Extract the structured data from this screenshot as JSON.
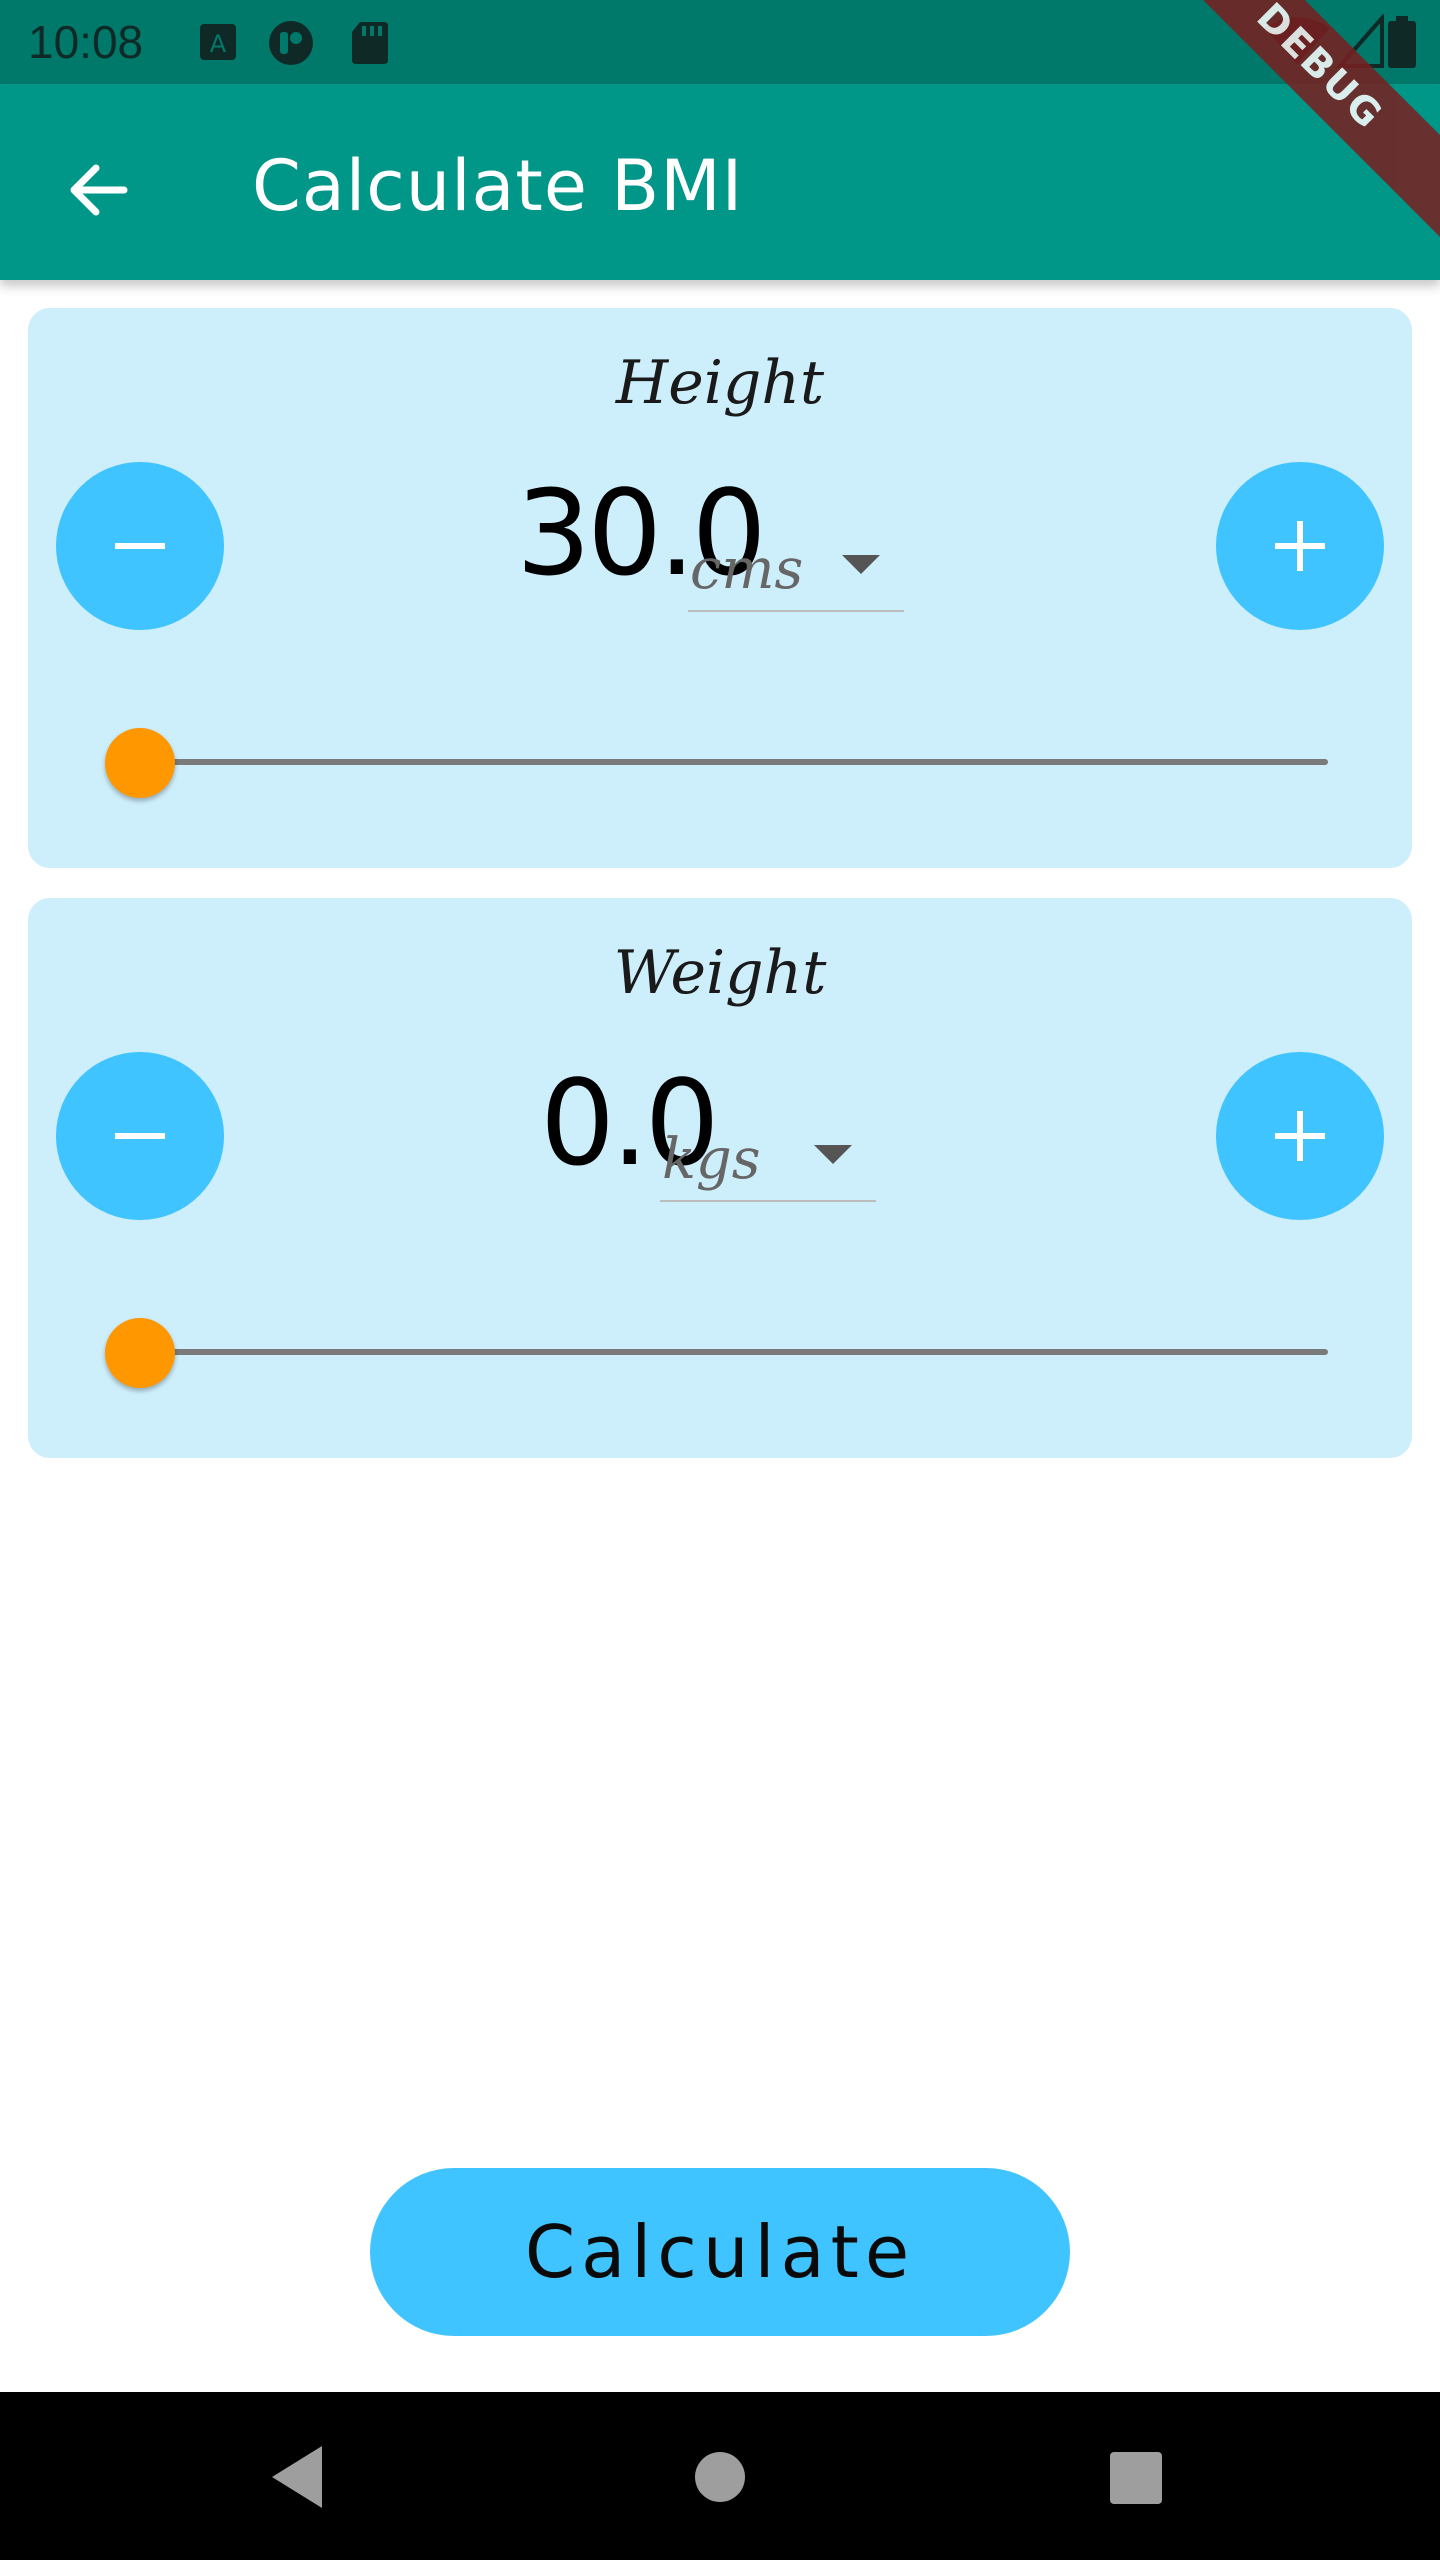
{
  "status_bar": {
    "time": "10:08"
  },
  "app_bar": {
    "title": "Calculate BMI"
  },
  "debug_banner": {
    "label": "DEBUG"
  },
  "height_card": {
    "label": "Height",
    "value": "30.0",
    "unit": "cms",
    "slider_level": 0.0
  },
  "weight_card": {
    "label": "Weight",
    "value": "0.0",
    "unit": "kgs",
    "slider_level": 0.0
  },
  "calculate_button": {
    "label": "Calculate"
  },
  "colors": {
    "status_bar": "#00796b",
    "app_bar": "#009688",
    "card_bg": "#cdeefb",
    "accent_blue": "#40c4ff",
    "slider_thumb": "#ff9800",
    "debug_ribbon": "#7a1f1f"
  },
  "icons": {
    "back": "arrow-left-icon",
    "minus": "minus-icon",
    "plus": "plus-icon",
    "dropdown": "caret-down-icon",
    "nav_back": "triangle-back-icon",
    "nav_home": "circle-home-icon",
    "nav_recents": "square-recents-icon"
  }
}
